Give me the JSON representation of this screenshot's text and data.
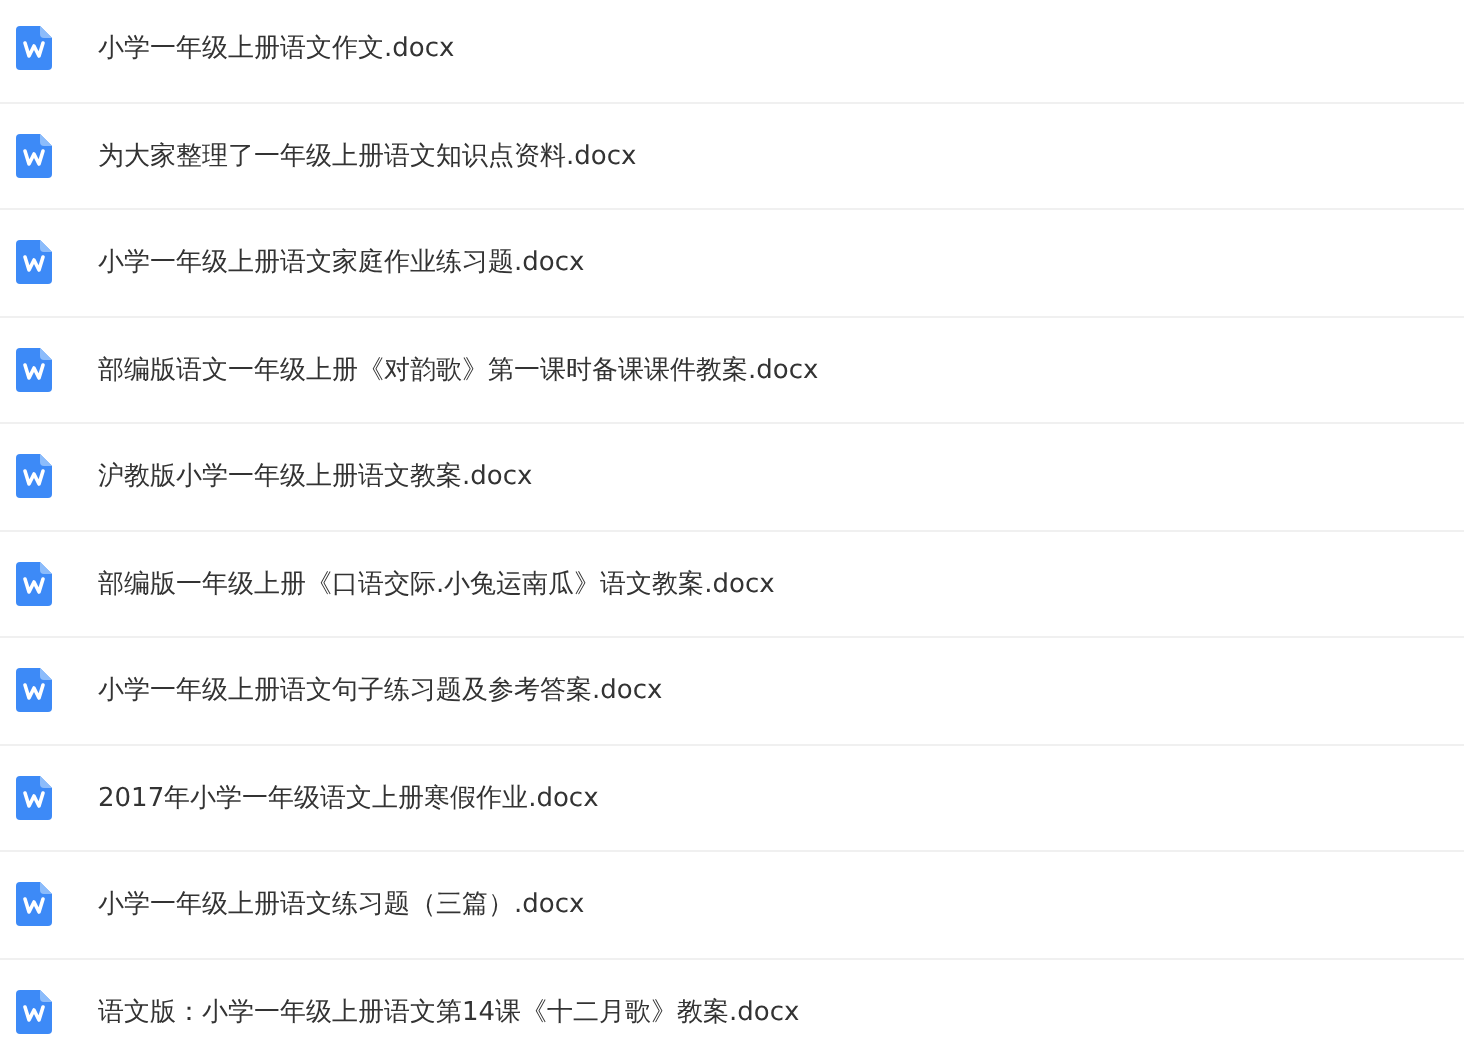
{
  "files": [
    {
      "name": "小学一年级上册语文作文.docx"
    },
    {
      "name": "为大家整理了一年级上册语文知识点资料.docx"
    },
    {
      "name": "小学一年级上册语文家庭作业练习题.docx"
    },
    {
      "name": "部编版语文一年级上册《对韵歌》第一课时备课课件教案.docx"
    },
    {
      "name": "沪教版小学一年级上册语文教案.docx"
    },
    {
      "name": "部编版一年级上册《口语交际.小兔运南瓜》语文教案.docx"
    },
    {
      "name": "小学一年级上册语文句子练习题及参考答案.docx"
    },
    {
      "name": "2017年小学一年级语文上册寒假作业.docx"
    },
    {
      "name": "小学一年级上册语文练习题（三篇）.docx"
    },
    {
      "name": "语文版：小学一年级上册语文第14课《十二月歌》教案.docx"
    }
  ]
}
